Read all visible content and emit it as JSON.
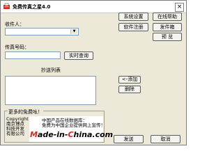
{
  "window": {
    "title": "免费传真之星4.0",
    "close_glyph": "×"
  },
  "form": {
    "recipient_label": "收件人：",
    "recipient_value": "",
    "fax_label": "传真号码：",
    "fax_value": "",
    "query_button": "实时查询",
    "cc_list_label": "抄送列表",
    "add_button": "<-添加",
    "delete_button": "删除"
  },
  "side_buttons": {
    "settings": "系统设置",
    "help": "在线帮助",
    "register": "软件注册",
    "outbox": "发件箱",
    "preview": "预 览"
  },
  "promo": {
    "title": "更多的免费吆！",
    "copyright_lines": [
      "Copyright",
      "南京博点",
      "科技开发",
      "有限公司"
    ],
    "notice_lines": [
      "中国产品在线数据库：",
      "免费为中国企业提供网上宣传！"
    ],
    "brand_parts": [
      "M",
      "ade-in-",
      "C",
      "hina.com"
    ]
  },
  "actions": {
    "send": "发送",
    "cancel": "取消"
  },
  "colors": {
    "window_bg": "#ece9d8",
    "brand_accent": "#d7281e"
  }
}
